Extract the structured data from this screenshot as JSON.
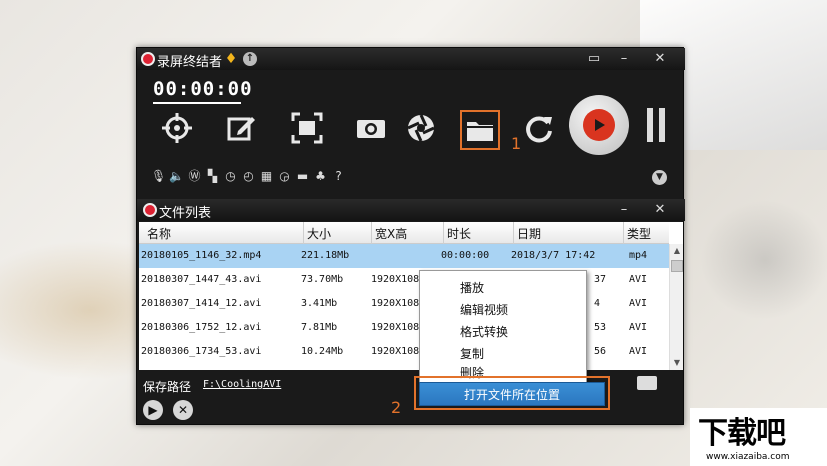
{
  "app": {
    "title": "录屏终结者",
    "timer": "00:00:00",
    "annotation_1": "1",
    "annotation_2": "2",
    "accent_color": "#e2722b"
  },
  "toolbar": {
    "icons": [
      "crosshair-icon",
      "edit-icon",
      "fullscreen-icon",
      "camera-icon",
      "aperture-icon",
      "folder-icon",
      "refresh-icon"
    ],
    "record": "record-button",
    "pause": "pause-button"
  },
  "options_bar": {
    "icons": [
      "microphone-icon",
      "speaker-icon",
      "wordpress-icon",
      "watermark-icon",
      "timer-icon",
      "clock-icon",
      "clapper-icon",
      "stopwatch-icon",
      "minus-icon",
      "shirt-icon",
      "help-icon"
    ]
  },
  "file_list": {
    "title": "文件列表",
    "columns": [
      "名称",
      "大小",
      "宽X高",
      "时长",
      "日期",
      "类型"
    ],
    "rows": [
      {
        "name": "20180105_1146_32.mp4",
        "size": "221.18Mb",
        "res": "",
        "duration": "00:00:00",
        "date": "2018/3/7 17:42",
        "type": "mp4"
      },
      {
        "name": "20180307_1447_43.avi",
        "size": "73.70Mb",
        "res": "1920X108",
        "duration": "",
        "date": "37",
        "type": "AVI"
      },
      {
        "name": "20180307_1414_12.avi",
        "size": "3.41Mb",
        "res": "1920X108",
        "duration": "",
        "date": "4",
        "type": "AVI"
      },
      {
        "name": "20180306_1752_12.avi",
        "size": "7.81Mb",
        "res": "1920X108",
        "duration": "",
        "date": "53",
        "type": "AVI"
      },
      {
        "name": "20180306_1734_53.avi",
        "size": "10.24Mb",
        "res": "1920X108",
        "duration": "",
        "date": "56",
        "type": "AVI"
      }
    ]
  },
  "save": {
    "label": "保存路径",
    "path": "F:\\CoolingAVI"
  },
  "context_menu": {
    "items": [
      "播放",
      "编辑视频",
      "格式转换",
      "复制",
      "删除"
    ],
    "highlighted": "打开文件所在位置"
  },
  "watermark": {
    "big": "下载吧",
    "small": "www.xiazaiba.com"
  }
}
